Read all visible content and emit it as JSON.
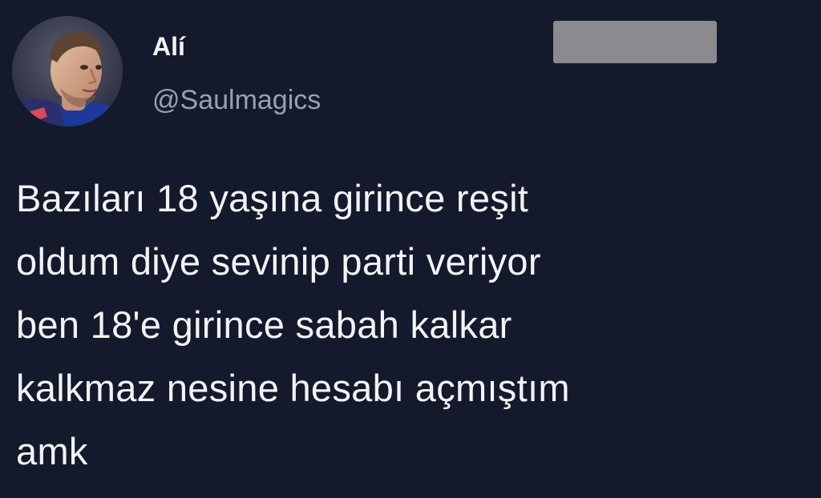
{
  "tweet": {
    "author": {
      "display_name": "Alí",
      "handle": "@Saulmagics",
      "avatar_icon": "user-avatar"
    },
    "text_lines": [
      "Bazıları 18 yaşına girince reşit",
      "oldum diye sevinip parti veriyor",
      "ben 18'e girince sabah kalkar",
      "kalkmaz nesine hesabı açmıştım",
      "amk"
    ]
  },
  "colors": {
    "background": "#14192b",
    "primary_text": "#f2f3f5",
    "secondary_text": "#9aa0ac",
    "redaction": "#8a8a8f"
  }
}
